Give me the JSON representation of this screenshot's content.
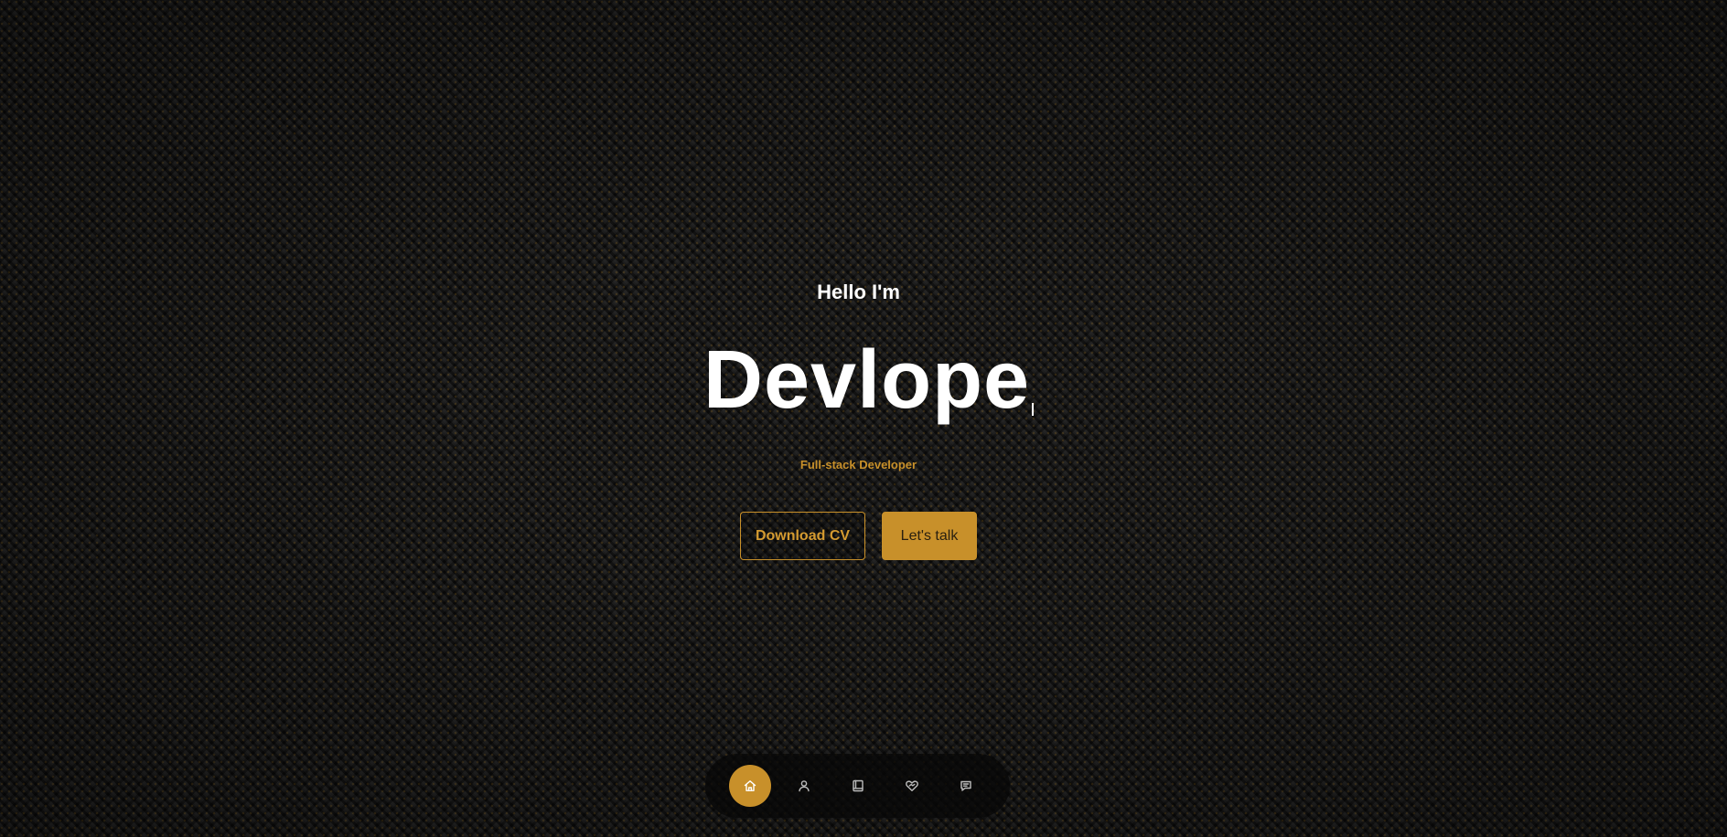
{
  "hero": {
    "greeting": "Hello I'm",
    "name_typed": "Devlope",
    "role": "Full-stack Developer",
    "buttons": {
      "download_cv": "Download CV",
      "lets_talk": "Let's talk"
    }
  },
  "nav": {
    "items": [
      {
        "icon": "home-icon",
        "active": true
      },
      {
        "icon": "user-icon",
        "active": false
      },
      {
        "icon": "book-icon",
        "active": false
      },
      {
        "icon": "heart-handshake-icon",
        "active": false
      },
      {
        "icon": "message-icon",
        "active": false
      }
    ]
  },
  "colors": {
    "accent": "#c8902a",
    "background": "#121212",
    "text": "#ffffff"
  }
}
